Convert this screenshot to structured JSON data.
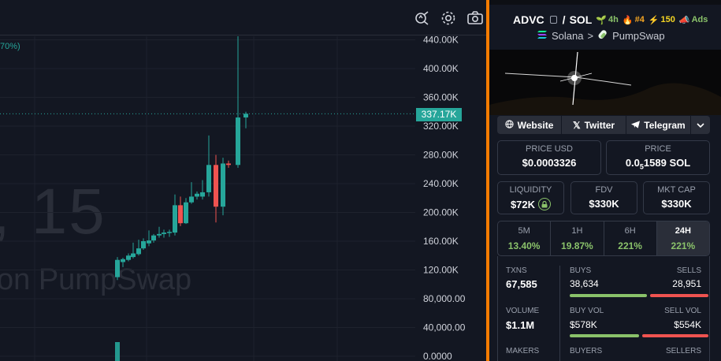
{
  "chart": {
    "pct_label": "70%)",
    "watermark_big": ", 15",
    "watermark_small": "on PumpSwap",
    "current_price": "337.17K",
    "y_axis_ticks": [
      "440.00K",
      "400.00K",
      "360.00K",
      "320.00K",
      "280.00K",
      "240.00K",
      "200.00K",
      "160.00K",
      "120.00K",
      "80,000.00",
      "40,000.00",
      "0.0000"
    ],
    "colors": {
      "up": "#26a69a",
      "down": "#ef5350"
    }
  },
  "chart_data": {
    "type": "candlestick",
    "ylim": [
      0,
      456000
    ],
    "grid": true,
    "candles": [
      {
        "x": 149,
        "o": 110000,
        "h": 138000,
        "l": 106000,
        "c": 134000
      },
      {
        "x": 156,
        "o": 131000,
        "h": 137000,
        "l": 124000,
        "c": 135000
      },
      {
        "x": 163,
        "o": 134000,
        "h": 143000,
        "l": 132000,
        "c": 140000
      },
      {
        "x": 169,
        "o": 138000,
        "h": 158000,
        "l": 136000,
        "c": 143000
      },
      {
        "x": 176,
        "o": 142000,
        "h": 162000,
        "l": 140000,
        "c": 150000
      },
      {
        "x": 182,
        "o": 150000,
        "h": 164000,
        "l": 148000,
        "c": 160000
      },
      {
        "x": 189,
        "o": 157000,
        "h": 175000,
        "l": 153000,
        "c": 161000
      },
      {
        "x": 195,
        "o": 161000,
        "h": 170000,
        "l": 158000,
        "c": 168000
      },
      {
        "x": 202,
        "o": 168000,
        "h": 180000,
        "l": 165000,
        "c": 170000
      },
      {
        "x": 208,
        "o": 170000,
        "h": 176000,
        "l": 165000,
        "c": 172000
      },
      {
        "x": 215,
        "o": 172000,
        "h": 176000,
        "l": 166000,
        "c": 173000
      },
      {
        "x": 222,
        "o": 172000,
        "h": 225000,
        "l": 168000,
        "c": 210000
      },
      {
        "x": 229,
        "o": 210000,
        "h": 222000,
        "l": 181000,
        "c": 185000
      },
      {
        "x": 236,
        "o": 185000,
        "h": 220000,
        "l": 184000,
        "c": 214000
      },
      {
        "x": 243,
        "o": 214000,
        "h": 242000,
        "l": 212000,
        "c": 222000
      },
      {
        "x": 250,
        "o": 222000,
        "h": 229000,
        "l": 218000,
        "c": 226000
      },
      {
        "x": 257,
        "o": 222000,
        "h": 245000,
        "l": 218000,
        "c": 228000
      },
      {
        "x": 265,
        "o": 228000,
        "h": 307000,
        "l": 222000,
        "c": 266000
      },
      {
        "x": 274,
        "o": 266000,
        "h": 280000,
        "l": 186000,
        "c": 208000
      },
      {
        "x": 283,
        "o": 208000,
        "h": 276000,
        "l": 196000,
        "c": 268000
      },
      {
        "x": 290,
        "o": 268000,
        "h": 272000,
        "l": 262000,
        "c": 266000
      },
      {
        "x": 302,
        "o": 266000,
        "h": 446000,
        "l": 262000,
        "c": 332000
      },
      {
        "x": 312,
        "o": 332000,
        "h": 340000,
        "l": 317000,
        "c": 337170
      }
    ],
    "volume_bar": {
      "x": 149,
      "value": 0.26
    }
  },
  "panel": {
    "pair_base": "ADVC",
    "pair_sep": "/",
    "pair_quote": "SOL",
    "age": "4h",
    "rank": "#4",
    "boost": "150",
    "ads": "Ads",
    "chain": "Solana",
    "chain_sep": ">",
    "dex": "PumpSwap",
    "links": {
      "website": "Website",
      "twitter": "Twitter",
      "telegram": "Telegram"
    },
    "price_usd_label": "PRICE USD",
    "price_usd": "$0.0003326",
    "price_sol_label": "PRICE",
    "price_sol_prefix": "0.0",
    "price_sol_sub": "5",
    "price_sol_rest": "1589 SOL",
    "liquidity_label": "LIQUIDITY",
    "liquidity": "$72K",
    "fdv_label": "FDV",
    "fdv": "$330K",
    "mcap_label": "MKT CAP",
    "mcap": "$330K",
    "tabs": [
      {
        "label": "5M",
        "value": "13.40%"
      },
      {
        "label": "1H",
        "value": "19.87%"
      },
      {
        "label": "6H",
        "value": "221%"
      },
      {
        "label": "24H",
        "value": "221%"
      }
    ],
    "txns_label": "TXNS",
    "txns": "67,585",
    "buys_label": "BUYS",
    "buys": "38,634",
    "sells_label": "SELLS",
    "sells": "28,951",
    "buys_fraction": 0.572,
    "volume_label": "VOLUME",
    "volume": "$1.1M",
    "buy_vol_label": "BUY VOL",
    "buy_vol": "$578K",
    "sell_vol_label": "SELL VOL",
    "sell_vol": "$554K",
    "buy_vol_fraction": 0.511,
    "makers_label": "MAKERS",
    "buyers_label": "BUYERS",
    "sellers_label": "SELLERS",
    "colors": {
      "green": "#8ac26a",
      "red": "#ef5350"
    }
  }
}
